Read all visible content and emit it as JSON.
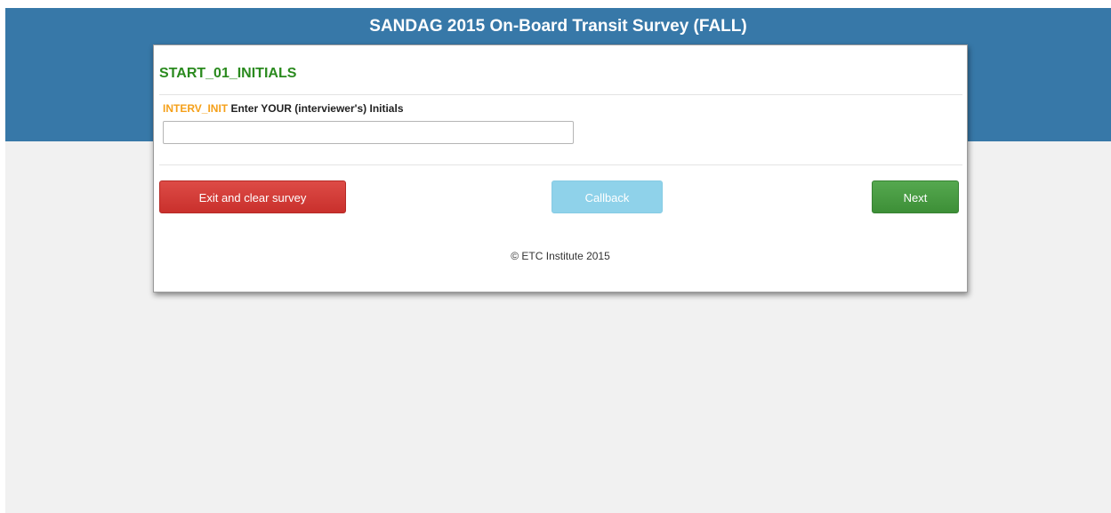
{
  "header": {
    "title": "SANDAG 2015 On-Board Transit Survey (FALL)"
  },
  "question": {
    "name": "START_01_INITIALS",
    "variable_code": "INTERV_INIT",
    "prompt": "Enter YOUR (interviewer's) Initials",
    "input_value": "",
    "input_placeholder": ""
  },
  "buttons": {
    "exit_label": "Exit and clear survey",
    "callback_label": "Callback",
    "next_label": "Next"
  },
  "footer": {
    "copyright": "© ETC Institute 2015"
  },
  "colors": {
    "banner": "#3778a8",
    "question_name": "#2a8a1e",
    "variable_code": "#f5a01a",
    "exit_button": "#d9534f",
    "callback_button": "#8fd2ea",
    "next_button": "#4cae4c"
  }
}
